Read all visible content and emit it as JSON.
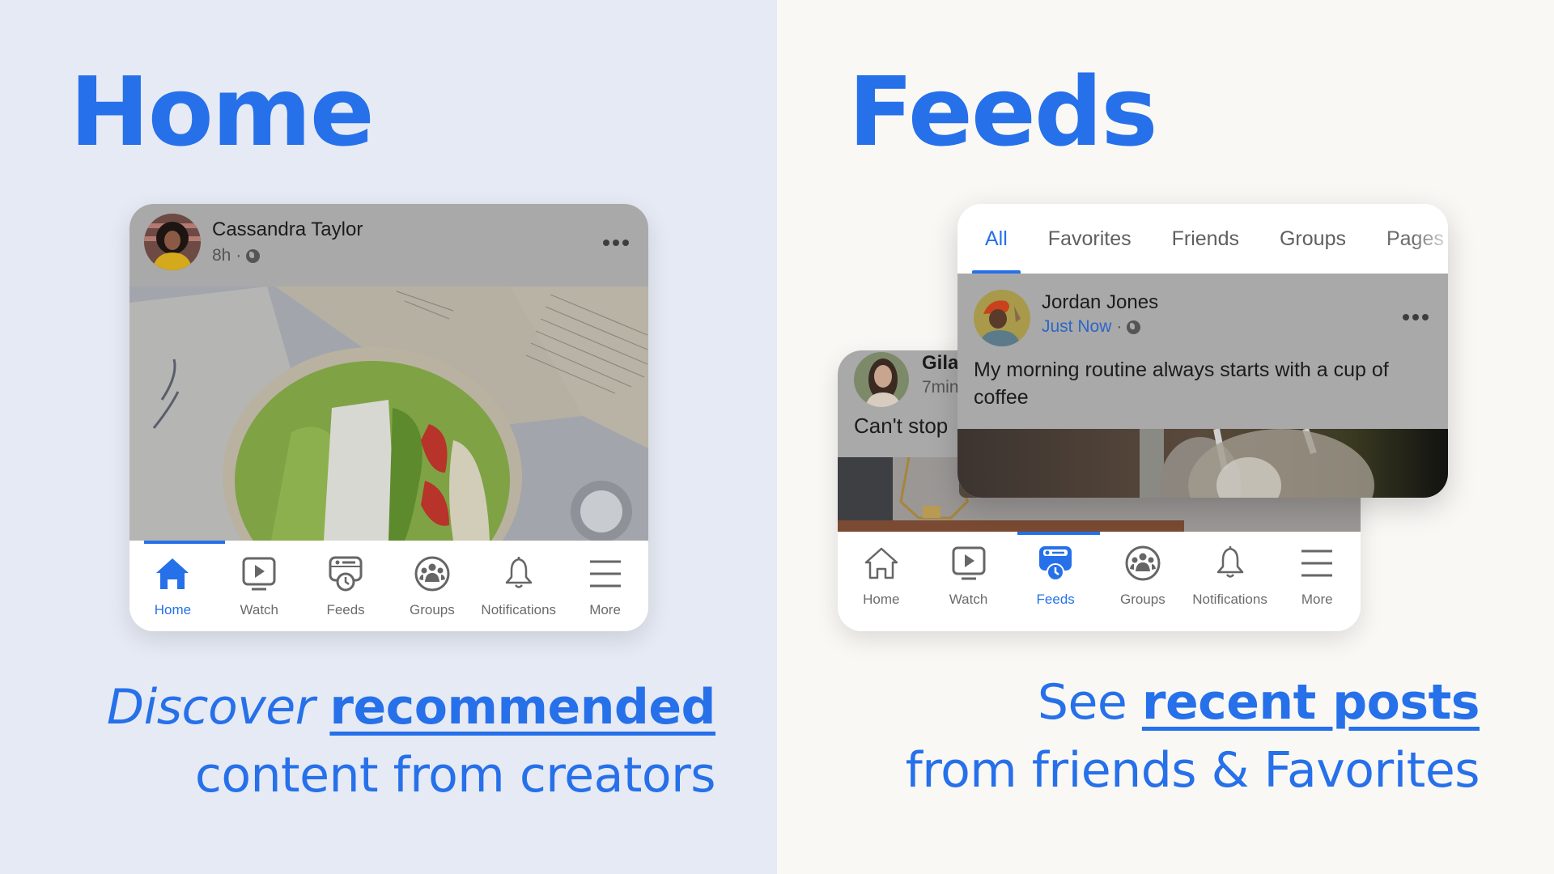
{
  "colors": {
    "accent": "#2670EA",
    "left_bg": "#E6EAF4",
    "right_bg": "#F9F8F5",
    "dim_overlay": "#A9A9A9"
  },
  "left": {
    "title": "Home",
    "tagline": {
      "line1_italic": "Discover",
      "line1_bold": "recommended",
      "line2": "content from creators"
    },
    "card": {
      "post": {
        "author": "Cassandra Taylor",
        "time": "8h",
        "separator": "·",
        "privacy_icon": "globe-icon",
        "menu_icon": "more-dots-icon",
        "image_alt": "Smoothie bowl with kiwi, strawberries, banana and coconut on top of open books"
      },
      "nav": {
        "active": "Home",
        "items": [
          {
            "label": "Home",
            "icon": "home-icon"
          },
          {
            "label": "Watch",
            "icon": "watch-icon"
          },
          {
            "label": "Feeds",
            "icon": "feeds-icon"
          },
          {
            "label": "Groups",
            "icon": "groups-icon"
          },
          {
            "label": "Notifications",
            "icon": "bell-icon"
          },
          {
            "label": "More",
            "icon": "menu-icon"
          }
        ]
      }
    }
  },
  "right": {
    "title": "Feeds",
    "tagline": {
      "line1_plain": "See",
      "line1_bold": "recent posts",
      "line2": "from friends & Favorites"
    },
    "front_card": {
      "tabs": [
        {
          "label": "All",
          "active": true
        },
        {
          "label": "Favorites",
          "active": false
        },
        {
          "label": "Friends",
          "active": false
        },
        {
          "label": "Groups",
          "active": false
        },
        {
          "label": "Pages",
          "active": false
        }
      ],
      "post": {
        "author": "Jordan Jones",
        "time": "Just Now",
        "separator": "·",
        "privacy_icon": "globe-icon",
        "menu_icon": "more-dots-icon",
        "text": "My morning routine always starts with a cup of coffee",
        "image_alt": "Milk being poured into a glass coffee mug"
      }
    },
    "back_card": {
      "post": {
        "author": "Gila",
        "time": "7min",
        "text": "Can't stop"
      },
      "nav": {
        "active": "Feeds",
        "items": [
          {
            "label": "Home",
            "icon": "home-icon"
          },
          {
            "label": "Watch",
            "icon": "watch-icon"
          },
          {
            "label": "Feeds",
            "icon": "feeds-icon"
          },
          {
            "label": "Groups",
            "icon": "groups-icon"
          },
          {
            "label": "Notifications",
            "icon": "bell-icon"
          },
          {
            "label": "More",
            "icon": "menu-icon"
          }
        ]
      }
    }
  }
}
